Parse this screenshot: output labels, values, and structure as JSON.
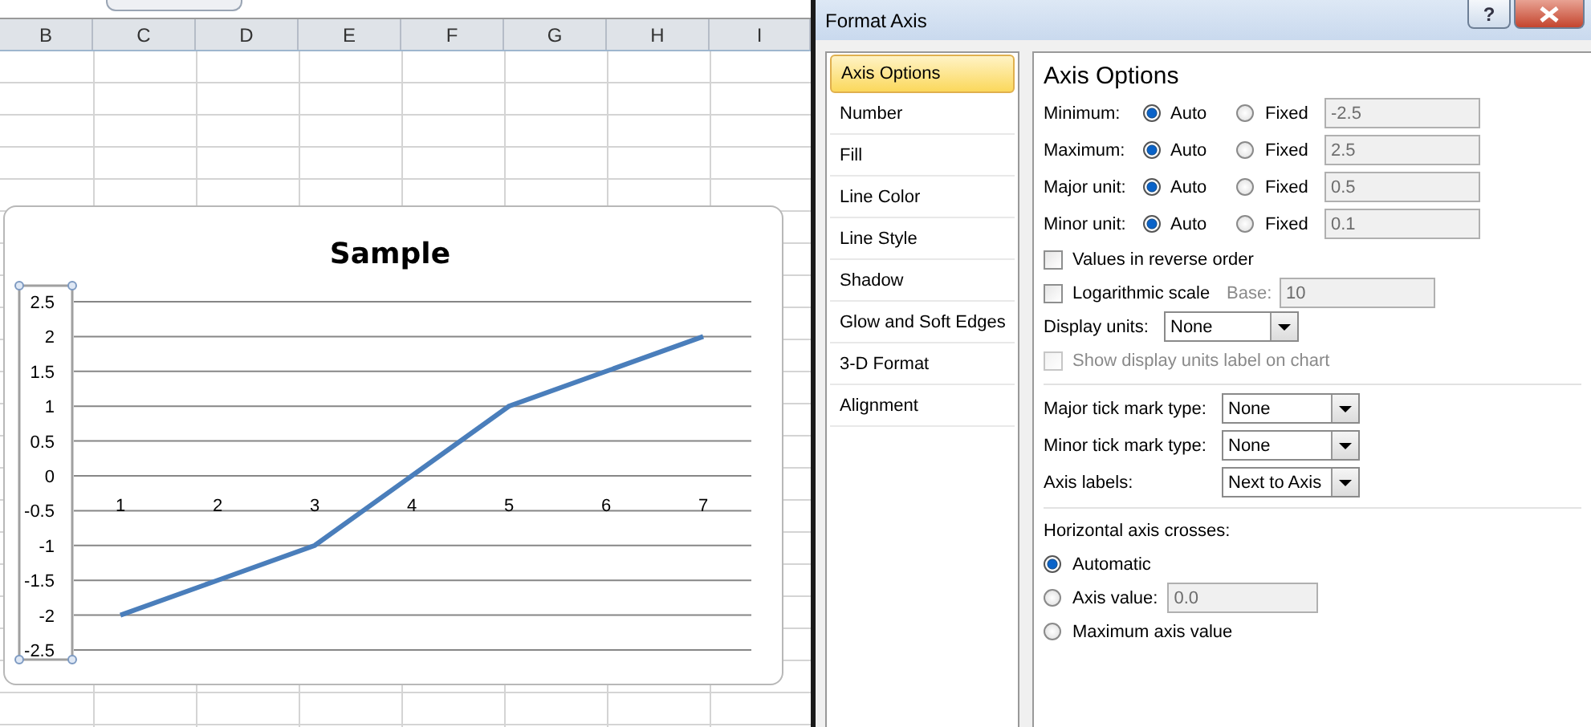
{
  "spreadsheet": {
    "columns": [
      "B",
      "C",
      "D",
      "E",
      "F",
      "G",
      "H",
      "I"
    ],
    "chart": {
      "y_axis_selected": true,
      "chart_data": {
        "type": "line",
        "title": "Sample",
        "categories": [
          "1",
          "2",
          "3",
          "4",
          "5",
          "6",
          "7"
        ],
        "series": [
          {
            "color": "#4a7ebb",
            "values": [
              -2,
              -1.5,
              -1,
              0,
              1,
              1.5,
              2
            ]
          }
        ],
        "grid": true,
        "ylim": [
          -2.5,
          2.5
        ],
        "yticks": [
          2.5,
          2,
          1.5,
          1,
          0.5,
          0,
          -0.5,
          -1,
          -1.5,
          -2,
          -2.5
        ]
      }
    }
  },
  "dialog": {
    "title": "Format Axis",
    "help_button": "?",
    "sidebar": [
      {
        "label": "Axis Options",
        "selected": true
      },
      {
        "label": "Number",
        "selected": false
      },
      {
        "label": "Fill",
        "selected": false
      },
      {
        "label": "Line Color",
        "selected": false
      },
      {
        "label": "Line Style",
        "selected": false
      },
      {
        "label": "Shadow",
        "selected": false
      },
      {
        "label": "Glow and Soft Edges",
        "selected": false
      },
      {
        "label": "3-D Format",
        "selected": false
      },
      {
        "label": "Alignment",
        "selected": false
      }
    ],
    "panel": {
      "heading": "Axis Options",
      "bounds": [
        {
          "label": "Minimum:",
          "options": [
            {
              "label": "Auto",
              "selected": true
            },
            {
              "label": "Fixed",
              "selected": false
            }
          ],
          "value": "-2.5",
          "disabled": true
        },
        {
          "label": "Maximum:",
          "options": [
            {
              "label": "Auto",
              "selected": true
            },
            {
              "label": "Fixed",
              "selected": false
            }
          ],
          "value": "2.5",
          "disabled": true
        },
        {
          "label": "Major unit:",
          "options": [
            {
              "label": "Auto",
              "selected": true
            },
            {
              "label": "Fixed",
              "selected": false
            }
          ],
          "value": "0.5",
          "disabled": true
        },
        {
          "label": "Minor unit:",
          "options": [
            {
              "label": "Auto",
              "selected": true
            },
            {
              "label": "Fixed",
              "selected": false
            }
          ],
          "value": "0.1",
          "disabled": true
        }
      ],
      "reverse_order": {
        "label": "Values in reverse order",
        "checked": false
      },
      "log_scale": {
        "label": "Logarithmic scale",
        "checked": false,
        "base_label": "Base:",
        "base_value": "10",
        "base_disabled": true
      },
      "display_units": {
        "label": "Display units:",
        "value": "None"
      },
      "show_units_label": {
        "label": "Show display units label on chart",
        "checked": false,
        "disabled": true
      },
      "tick_settings": [
        {
          "label": "Major tick mark type:",
          "value": "None"
        },
        {
          "label": "Minor tick mark type:",
          "value": "None"
        },
        {
          "label": "Axis labels:",
          "value": "Next to Axis"
        }
      ],
      "crosses": {
        "heading": "Horizontal axis crosses:",
        "options": [
          {
            "label": "Automatic",
            "selected": true
          },
          {
            "label": "Axis value:",
            "selected": false,
            "value": "0.0",
            "disabled": true
          },
          {
            "label": "Maximum axis value",
            "selected": false
          }
        ]
      }
    }
  }
}
